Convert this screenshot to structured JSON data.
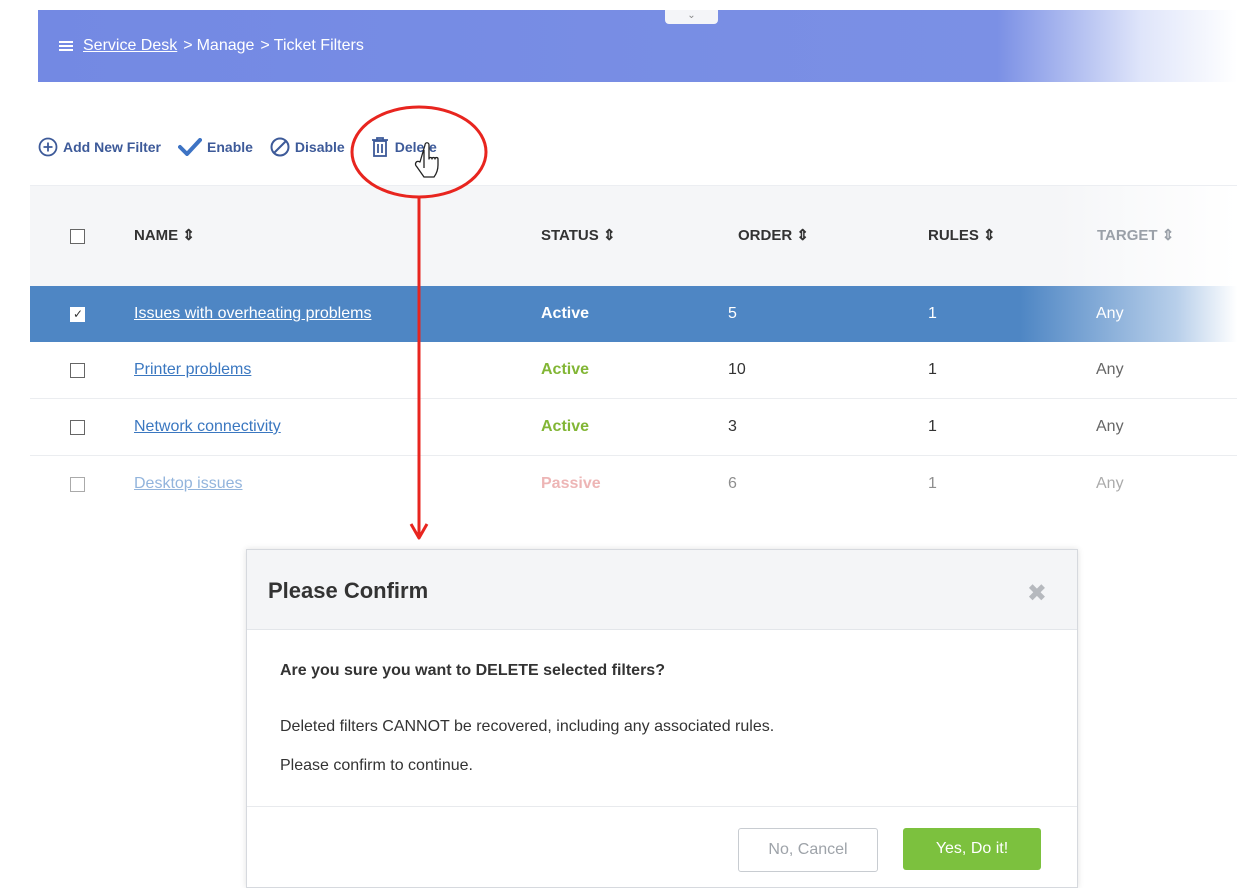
{
  "header": {
    "breadcrumb": [
      {
        "label": "Service Desk",
        "link": true
      },
      {
        "label": "Manage",
        "link": false
      },
      {
        "label": "Ticket Filters",
        "link": false
      }
    ],
    "separator": ">",
    "collapse_glyph": "⌄"
  },
  "toolbar": {
    "add_label": "Add New Filter",
    "enable_label": "Enable",
    "disable_label": "Disable",
    "delete_label": "Delete"
  },
  "table": {
    "columns": [
      "NAME ⇕",
      "STATUS ⇕",
      "ORDER ⇕",
      "RULES ⇕",
      "TARGET ⇕"
    ],
    "rows": [
      {
        "name": "Issues with overheating problems",
        "status": "Active",
        "order": "5",
        "rules": "1",
        "target": "Any",
        "selected": true
      },
      {
        "name": "Printer problems",
        "status": "Active",
        "order": "10",
        "rules": "1",
        "target": "Any",
        "selected": false
      },
      {
        "name": "Network connectivity",
        "status": "Active",
        "order": "3",
        "rules": "1",
        "target": "Any",
        "selected": false
      },
      {
        "name": "Desktop issues",
        "status": "Passive",
        "order": "6",
        "rules": "1",
        "target": "Any",
        "selected": false
      }
    ]
  },
  "dialog": {
    "title": "Please Confirm",
    "close_glyph": "✖",
    "question": "Are you sure you want to DELETE selected filters?",
    "line1": "Deleted filters CANNOT be recovered, including any associated rules.",
    "line2": "Please confirm to continue.",
    "cancel_label": "No, Cancel",
    "confirm_label": "Yes, Do it!"
  },
  "colors": {
    "header": "#7389e3",
    "selected_row": "#4e86c4",
    "active": "#82b635",
    "passive": "#e07a7a",
    "confirm": "#7cc13e",
    "annotation": "#e8251f"
  },
  "icons": [
    "menu-icon",
    "add-circle-icon",
    "check-icon",
    "disable-icon",
    "trash-icon",
    "hand-cursor-icon",
    "close-icon"
  ]
}
